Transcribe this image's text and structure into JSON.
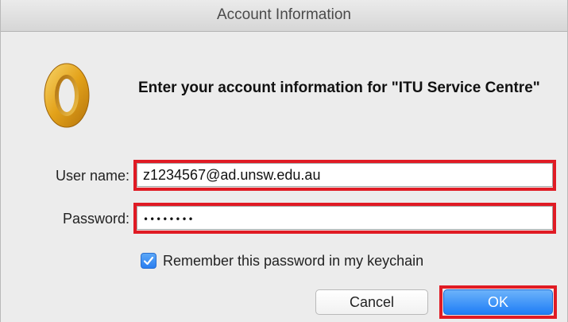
{
  "window": {
    "title": "Account Information"
  },
  "app_icon": {
    "name": "outlook-icon",
    "color": "#e3a21a"
  },
  "heading": "Enter your account information for \"ITU Service Centre\"",
  "fields": {
    "username": {
      "label": "User name:",
      "value": "z1234567@ad.unsw.edu.au"
    },
    "password": {
      "label": "Password:",
      "value": "••••••••"
    }
  },
  "remember": {
    "label": "Remember this password in my keychain",
    "checked": true
  },
  "buttons": {
    "cancel": "Cancel",
    "ok": "OK"
  },
  "colors": {
    "highlight": "#e01b24",
    "accent": "#1f7df6"
  }
}
